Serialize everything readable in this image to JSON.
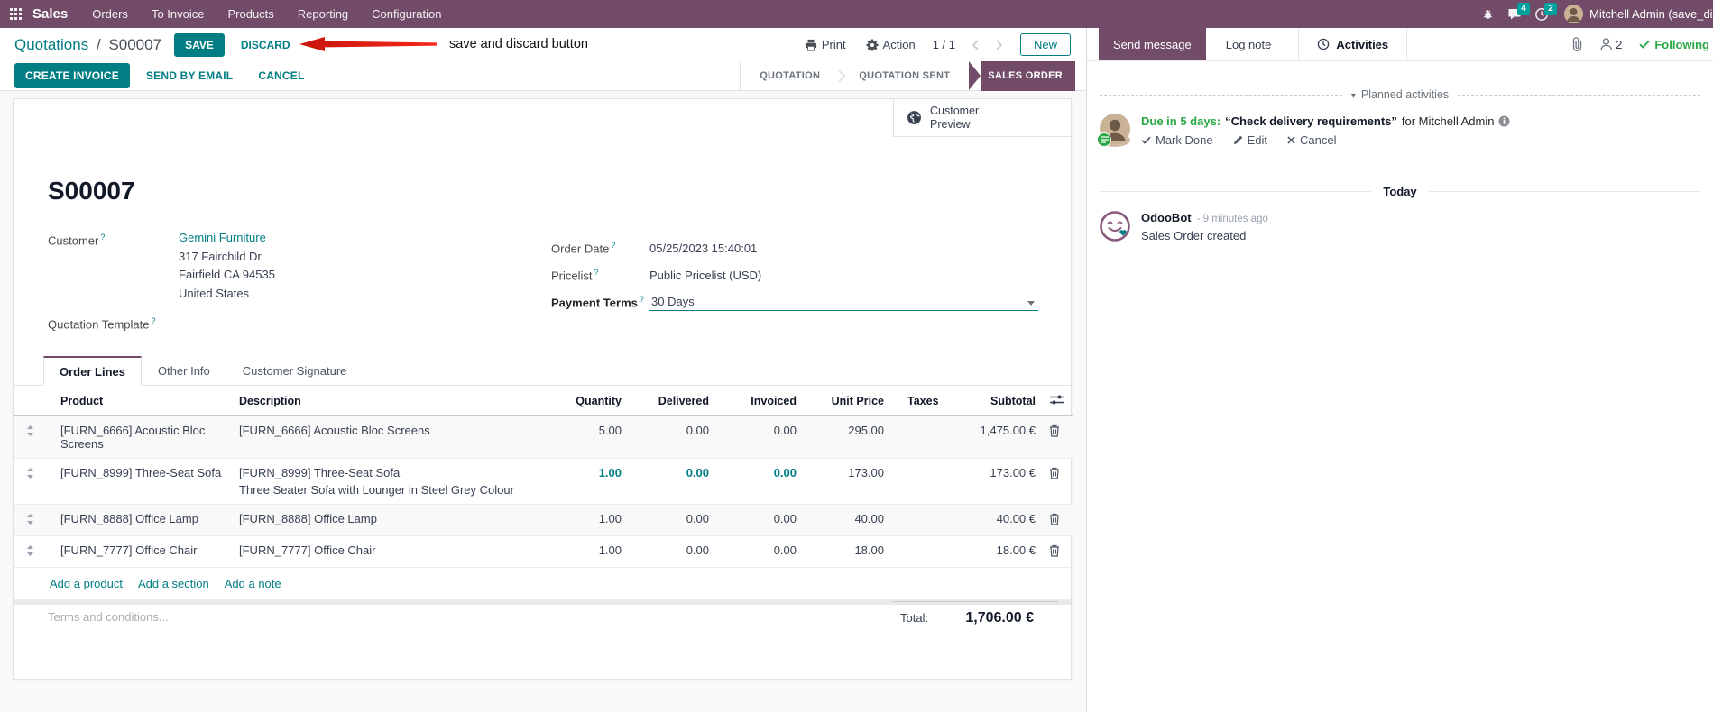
{
  "colors": {
    "navbar_bg": "#714B67",
    "primary_teal": "#017E84",
    "badge_bg": "#00A09D",
    "success_green": "#28a745",
    "annotation_red": "#DB2C1F",
    "stage_active_bg": "#714B67"
  },
  "navbar": {
    "app_name": "Sales",
    "menus": [
      "Orders",
      "To Invoice",
      "Products",
      "Reporting",
      "Configuration"
    ],
    "messages_badge": "4",
    "activities_badge": "2",
    "user_name": "Mitchell Admin (save_discard"
  },
  "breadcrumb": {
    "parent": "Quotations",
    "separator": "/",
    "current": "S00007",
    "save_label": "SAVE",
    "discard_label": "DISCARD"
  },
  "annotation": {
    "label": "save and discard button"
  },
  "control_panel": {
    "print_label": "Print",
    "action_label": "Action",
    "pager": "1 / 1",
    "new_label": "New"
  },
  "action_buttons": {
    "create_invoice": "CREATE INVOICE",
    "send_by_email": "SEND BY EMAIL",
    "cancel": "CANCEL"
  },
  "statusbar": {
    "quotation": "QUOTATION",
    "quotation_sent": "QUOTATION SENT",
    "sales_order": "SALES ORDER"
  },
  "sheet": {
    "customer_preview_label": "Customer Preview",
    "order_reference": "S00007",
    "help_marker": "?",
    "customer": {
      "label": "Customer",
      "name": "Gemini Furniture",
      "street": "317 Fairchild Dr",
      "city": "Fairfield CA 94535",
      "country": "United States"
    },
    "order_date": {
      "label": "Order Date",
      "value": "05/25/2023 15:40:01"
    },
    "pricelist": {
      "label": "Pricelist",
      "value": "Public Pricelist (USD)"
    },
    "payment_terms": {
      "label": "Payment Terms",
      "value": "30 Days"
    },
    "quotation_template": {
      "label": "Quotation Template"
    },
    "tabs": [
      "Order Lines",
      "Other Info",
      "Customer Signature"
    ],
    "table": {
      "headers": {
        "product": "Product",
        "description": "Description",
        "quantity": "Quantity",
        "delivered": "Delivered",
        "invoiced": "Invoiced",
        "unit_price": "Unit Price",
        "taxes": "Taxes",
        "subtotal": "Subtotal"
      },
      "rows": [
        {
          "product": "[FURN_6666] Acoustic Bloc Screens",
          "description": "[FURN_6666] Acoustic Bloc Screens",
          "description_line2": "",
          "quantity": "5.00",
          "delivered": "0.00",
          "invoiced": "0.00",
          "unit_price": "295.00",
          "taxes": "",
          "subtotal": "1,475.00 €"
        },
        {
          "product": "[FURN_8999] Three-Seat Sofa",
          "description": "[FURN_8999] Three-Seat Sofa",
          "description_line2": "Three Seater Sofa with Lounger in Steel Grey Colour",
          "quantity": "1.00",
          "delivered": "0.00",
          "invoiced": "0.00",
          "unit_price": "173.00",
          "taxes": "",
          "subtotal": "173.00 €"
        },
        {
          "product": "[FURN_8888] Office Lamp",
          "description": "[FURN_8888] Office Lamp",
          "description_line2": "",
          "quantity": "1.00",
          "delivered": "0.00",
          "invoiced": "0.00",
          "unit_price": "40.00",
          "taxes": "",
          "subtotal": "40.00 €"
        },
        {
          "product": "[FURN_7777] Office Chair",
          "description": "[FURN_7777] Office Chair",
          "description_line2": "",
          "quantity": "1.00",
          "delivered": "0.00",
          "invoiced": "0.00",
          "unit_price": "18.00",
          "taxes": "",
          "subtotal": "18.00 €"
        }
      ],
      "add_links": [
        "Add a product",
        "Add a section",
        "Add a note"
      ]
    },
    "terms_placeholder": "Terms and conditions...",
    "total": {
      "label": "Total:",
      "value": "1,706.00 €"
    }
  },
  "chatter": {
    "send_message": "Send message",
    "log_note": "Log note",
    "activities": "Activities",
    "followers_count": "2",
    "following": "Following",
    "planned_activities_title": "Planned activities",
    "activity": {
      "due": "Due in 5 days:",
      "summary": "“Check delivery requirements”",
      "assignee": "for Mitchell Admin",
      "mark_done": "Mark Done",
      "edit": "Edit",
      "cancel": "Cancel"
    },
    "today_label": "Today",
    "message": {
      "author": "OdooBot",
      "timestamp": "- 9 minutes ago",
      "body": "Sales Order created"
    }
  }
}
